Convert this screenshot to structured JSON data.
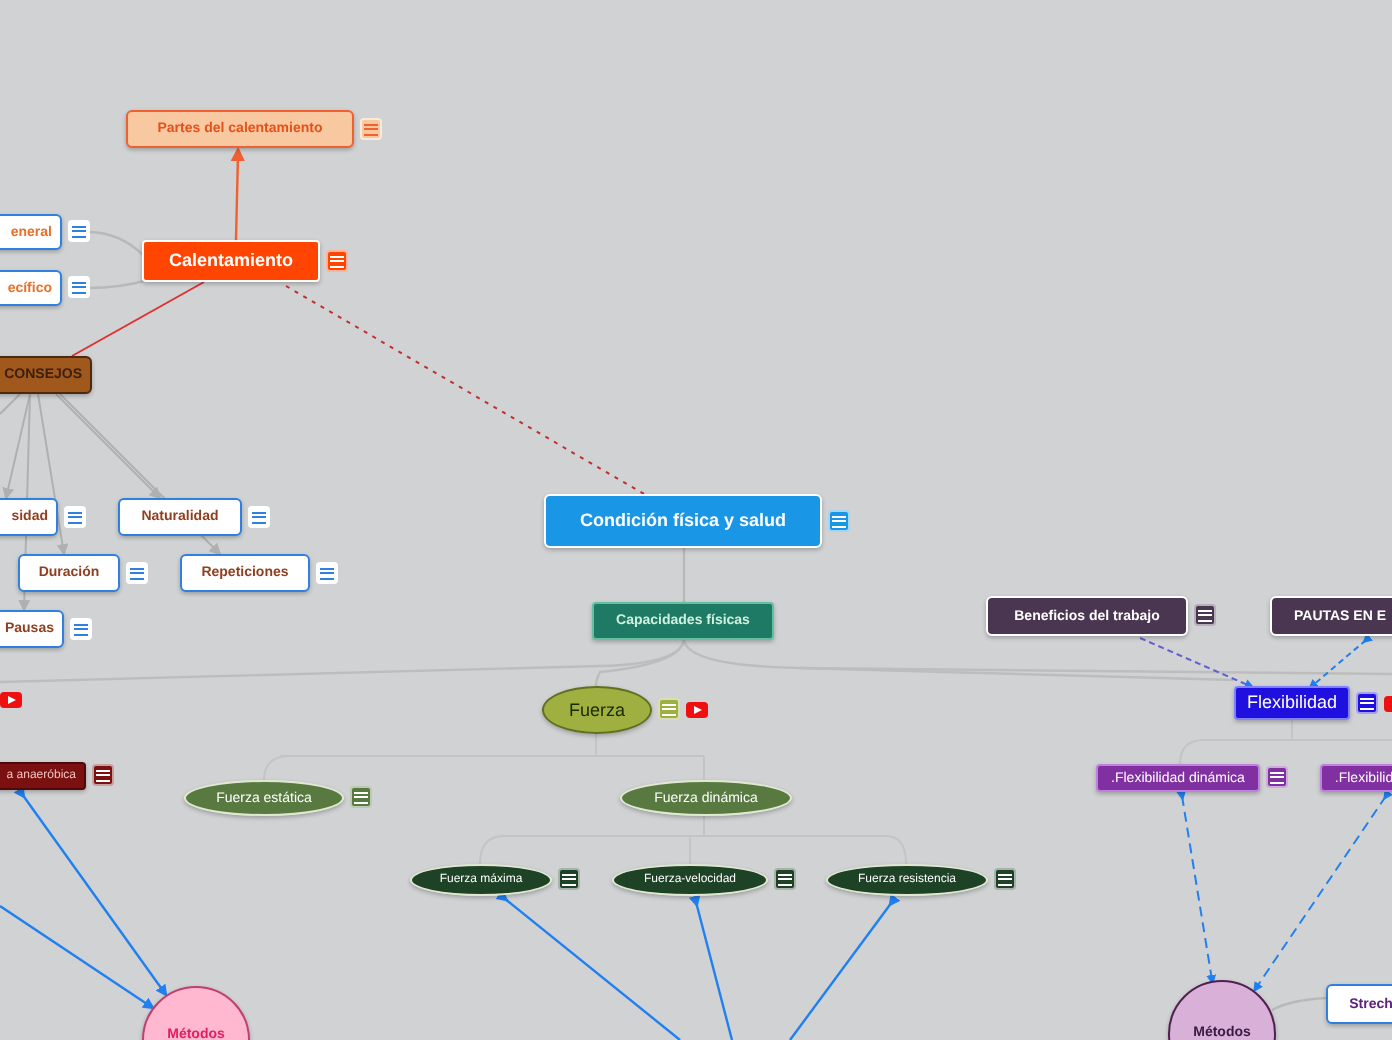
{
  "nodes": [
    {
      "text": "Partes del calentamiento",
      "kind": "box",
      "color": "#f8c8a0",
      "note": true,
      "video": false
    },
    {
      "text": "eneral",
      "kind": "box",
      "color": "#ffffff",
      "note": true,
      "video": false
    },
    {
      "text": "ecífico",
      "kind": "box",
      "color": "#ffffff",
      "note": true,
      "video": false
    },
    {
      "text": "Calentamiento",
      "kind": "box",
      "color": "#ff4500",
      "note": true,
      "video": false
    },
    {
      "text": "CONSEJOS",
      "kind": "box",
      "color": "#a0581c",
      "note": false,
      "video": false
    },
    {
      "text": "sidad",
      "kind": "box",
      "color": "#ffffff",
      "note": true,
      "video": false
    },
    {
      "text": "Naturalidad",
      "kind": "box",
      "color": "#ffffff",
      "note": true,
      "video": false
    },
    {
      "text": "Duración",
      "kind": "box",
      "color": "#ffffff",
      "note": true,
      "video": false
    },
    {
      "text": "Repeticiones",
      "kind": "box",
      "color": "#ffffff",
      "note": true,
      "video": false
    },
    {
      "text": "Pausas",
      "kind": "box",
      "color": "#ffffff",
      "note": true,
      "video": false
    },
    {
      "text": "Condición física y salud",
      "kind": "box",
      "color": "#1a96e6",
      "note": true,
      "video": false
    },
    {
      "text": "Capacidades físicas",
      "kind": "box",
      "color": "#1e7a64",
      "note": false,
      "video": false
    },
    {
      "text": "Fuerza",
      "kind": "ellipse",
      "color": "#a0b040",
      "note": true,
      "video": true
    },
    {
      "kind": "offscreen",
      "note": false,
      "video": true
    },
    {
      "text": "a anaeróbica",
      "kind": "box",
      "color": "#7a1010",
      "note": true,
      "video": false
    },
    {
      "text": "Fuerza estática",
      "kind": "ellipse",
      "color": "#587a40",
      "note": true,
      "video": false
    },
    {
      "text": "Fuerza dinámica",
      "kind": "ellipse",
      "color": "#587a40",
      "note": false,
      "video": false
    },
    {
      "text": "Fuerza máxima",
      "kind": "ellipse",
      "color": "#1e4226",
      "note": true,
      "video": false
    },
    {
      "text": "Fuerza-velocidad",
      "kind": "ellipse",
      "color": "#1e4226",
      "note": true,
      "video": false
    },
    {
      "text": "Fuerza resistencia",
      "kind": "ellipse",
      "color": "#1e4226",
      "note": true,
      "video": false
    },
    {
      "text": "Beneficios del trabajo",
      "kind": "box",
      "color": "#4a3650",
      "note": true,
      "video": false
    },
    {
      "text": "PAUTAS EN E",
      "kind": "box",
      "color": "#4a3650",
      "note": false,
      "video": false
    },
    {
      "text": "Flexibilidad",
      "kind": "box",
      "color": "#2010e0",
      "note": true,
      "video": true
    },
    {
      "text": ".Flexibilidad dinámica",
      "kind": "box",
      "color": "#8030a0",
      "note": true,
      "video": false
    },
    {
      "text": ".Flexibilid",
      "kind": "box",
      "color": "#8030a0",
      "note": false,
      "video": false
    },
    {
      "text": "Métodos",
      "kind": "circle",
      "color": "#ffb8d0",
      "note": false,
      "video": false
    },
    {
      "text": "Métodos",
      "kind": "circle",
      "color": "#d8b0d8",
      "note": false,
      "video": false
    },
    {
      "text": "Strech",
      "kind": "box",
      "color": "#ffffff",
      "note": false,
      "video": false
    }
  ]
}
